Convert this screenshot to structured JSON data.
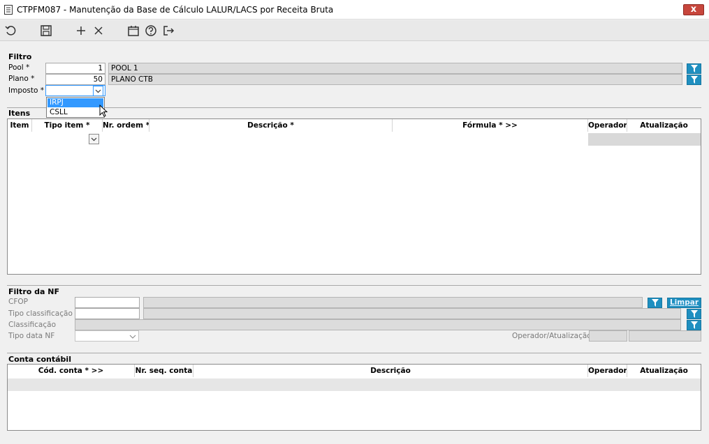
{
  "window": {
    "title": "CTPFM087 - Manutenção da Base de Cálculo LALUR/LACS por Receita Bruta",
    "close_label": "x"
  },
  "filtro": {
    "title": "Filtro",
    "pool_label": "Pool *",
    "pool_value": "1",
    "pool_desc": "POOL 1",
    "plano_label": "Plano *",
    "plano_value": "50",
    "plano_desc": "PLANO CTB",
    "imposto_label": "Imposto *",
    "imposto_value": "",
    "imposto_options": [
      "IRPJ",
      "CSLL"
    ]
  },
  "itens": {
    "title": "Itens",
    "columns": [
      "Item",
      "Tipo item *",
      "Nr. ordem *",
      "Descrição *",
      "Fórmula * >>",
      "Operador",
      "Atualização"
    ]
  },
  "filtro_nf": {
    "title": "Filtro da NF",
    "cfop_label": "CFOP",
    "tipo_classificacao_label": "Tipo classificação",
    "classificacao_label": "Classificação",
    "tipo_data_label": "Tipo data NF",
    "operador_atualizacao_label": "Operador/Atualização",
    "limpar_label": "Limpar"
  },
  "conta_contabil": {
    "title": "Conta contábil",
    "columns": [
      "Cód. conta * >>",
      "Nr. seq. conta",
      "Descrição",
      "Operador",
      "Atualização"
    ]
  },
  "colors": {
    "accent": "#1f8fc0",
    "selection": "#3399ff",
    "close": "#c7463c"
  }
}
